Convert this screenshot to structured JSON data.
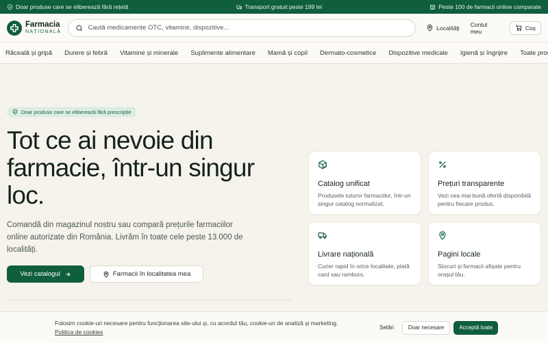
{
  "topbar": {
    "left": "Doar produse care se eliberează fără rețetă",
    "center": "Transport gratuit peste 199 lei",
    "right": "Peste 100 de farmacii online comparate"
  },
  "logo": {
    "name": "Farmacia",
    "sub": "NAȚIONALĂ"
  },
  "search": {
    "placeholder": "Caută medicamente OTC, vitamine, dispozitive..."
  },
  "header_actions": {
    "location": "Localități",
    "account": "Contul meu",
    "cart": "Coș"
  },
  "categories": [
    "Răceală și gripă",
    "Durere și febră",
    "Vitamine și minerale",
    "Suplimente alimentare",
    "Mamă și copil",
    "Dermato-cosmetice",
    "Dispozitive medicale",
    "Igienă și îngrijire",
    "Toate produsele"
  ],
  "hero": {
    "badge": "Doar produse care se eliberează fără prescripție",
    "headline": "Tot ce ai nevoie din farmacie, într-un singur loc.",
    "lead": "Comandă din magazinul nostru sau compară prețurile farmaciilor online autorizate din România. Livrăm în toate cele peste 13.000 de localități.",
    "cta_primary": "Vezi catalogul",
    "cta_secondary": "Farmacii în localitatea mea"
  },
  "features": [
    {
      "icon": "package-check-icon",
      "title": "Catalog unificat",
      "desc": "Produsele tuturor farmaciilor, într-un singur catalog normalizat."
    },
    {
      "icon": "percent-icon",
      "title": "Prețuri transparente",
      "desc": "Vezi cea mai bună ofertă disponibilă pentru fiecare produs."
    },
    {
      "icon": "truck-icon",
      "title": "Livrare națională",
      "desc": "Curier rapid în orice localitate, plată card sau ramburs."
    },
    {
      "icon": "map-pin-icon",
      "title": "Pagini locale",
      "desc": "Stocuri și farmacii afișate pentru orașul tău."
    }
  ],
  "cookie": {
    "text": "Folosim cookie-uri necesare pentru funcționarea site-ului și, cu acordul tău, cookie-uri de analiză și marketing.",
    "policy_link": "Politica de cookies",
    "settings": "Setări",
    "necessary": "Doar necesare",
    "accept": "Acceptă toate"
  },
  "colors": {
    "brand": "#0f5e3c",
    "background": "#f6f3ec",
    "badge_bg": "#dbeee2"
  }
}
